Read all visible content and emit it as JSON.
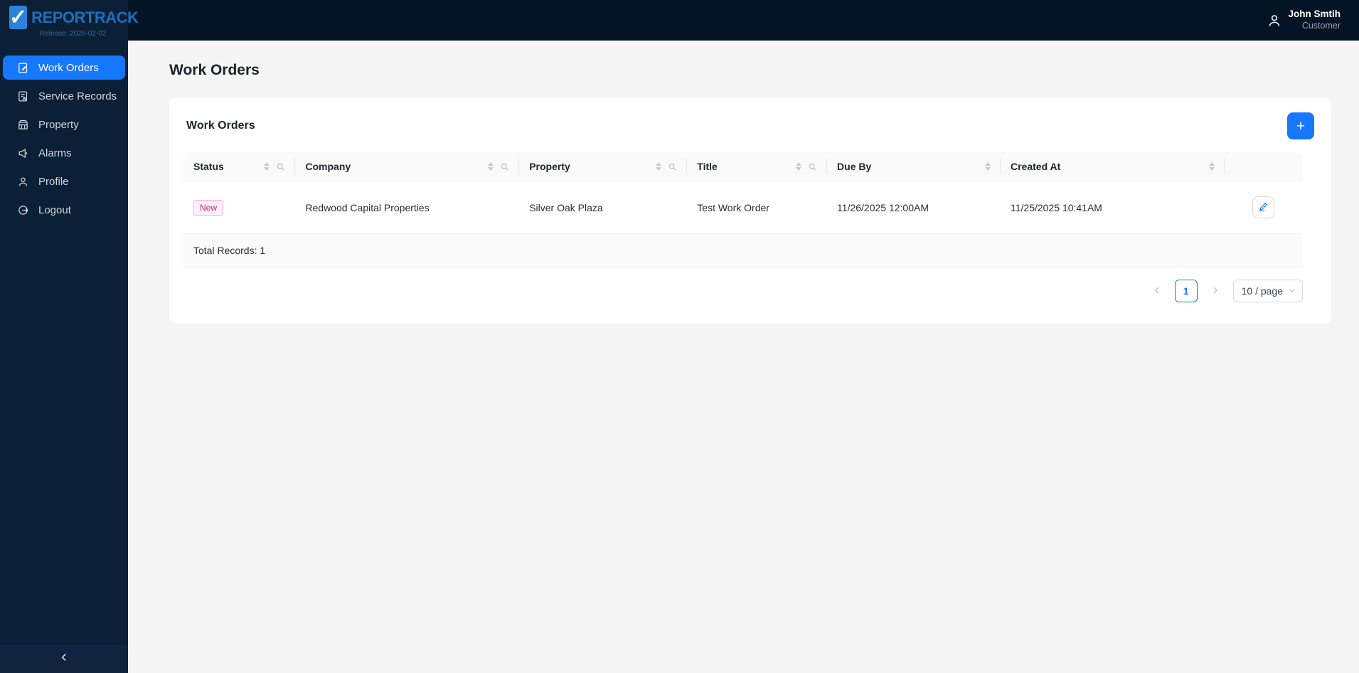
{
  "brand": {
    "name": "REPORTRACK",
    "release": "Release: 2026-02-02",
    "logo_check": "✓"
  },
  "header": {
    "user_name": "John Smtih",
    "user_role": "Customer"
  },
  "sidebar": {
    "items": [
      {
        "label": "Work Orders",
        "icon": "work-orders-icon",
        "active": true
      },
      {
        "label": "Service Records",
        "icon": "service-records-icon",
        "active": false
      },
      {
        "label": "Property",
        "icon": "property-icon",
        "active": false
      },
      {
        "label": "Alarms",
        "icon": "alarms-icon",
        "active": false
      },
      {
        "label": "Profile",
        "icon": "profile-icon",
        "active": false
      },
      {
        "label": "Logout",
        "icon": "logout-icon",
        "active": false
      }
    ]
  },
  "page": {
    "title": "Work Orders"
  },
  "card": {
    "title": "Work Orders",
    "add_button_label": "+"
  },
  "table": {
    "columns": [
      {
        "label": "Status",
        "sortable": true,
        "searchable": true
      },
      {
        "label": "Company",
        "sortable": true,
        "searchable": true
      },
      {
        "label": "Property",
        "sortable": true,
        "searchable": true
      },
      {
        "label": "Title",
        "sortable": true,
        "searchable": true
      },
      {
        "label": "Due By",
        "sortable": true,
        "searchable": false
      },
      {
        "label": "Created At",
        "sortable": true,
        "searchable": false
      }
    ],
    "rows": [
      {
        "status": "New",
        "company": "Redwood Capital Properties",
        "property": "Silver Oak Plaza",
        "title": "Test Work Order",
        "due_by": "11/26/2025 12:00AM",
        "created_at": "11/25/2025 10:41AM"
      }
    ],
    "summary": "Total Records: 1"
  },
  "pagination": {
    "current_page": "1",
    "page_size_label": "10 / page"
  },
  "colors": {
    "primary": "#1677ff",
    "header_bg": "#041426",
    "sidebar_bg": "#0b1f36",
    "trigger_bg": "#102440",
    "content_bg": "#f5f5f5",
    "tag_new_text": "#c41d7f",
    "tag_new_bg": "#fff0f6",
    "tag_new_border": "#ffadd2"
  }
}
